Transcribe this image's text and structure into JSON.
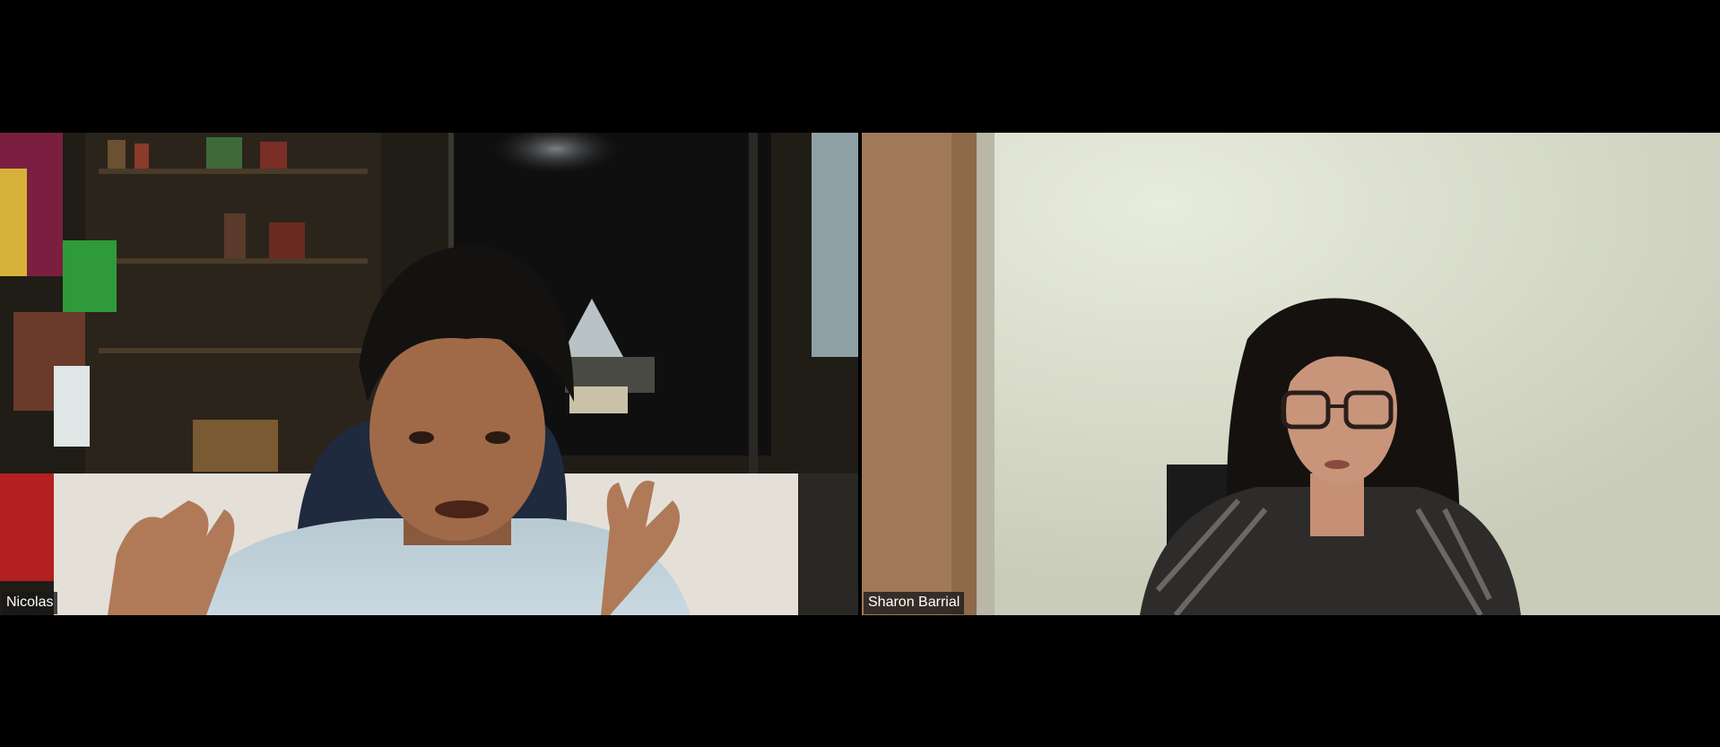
{
  "meeting": {
    "participants": [
      {
        "name": "Nicolas"
      },
      {
        "name": "Sharon Barrial"
      }
    ]
  }
}
